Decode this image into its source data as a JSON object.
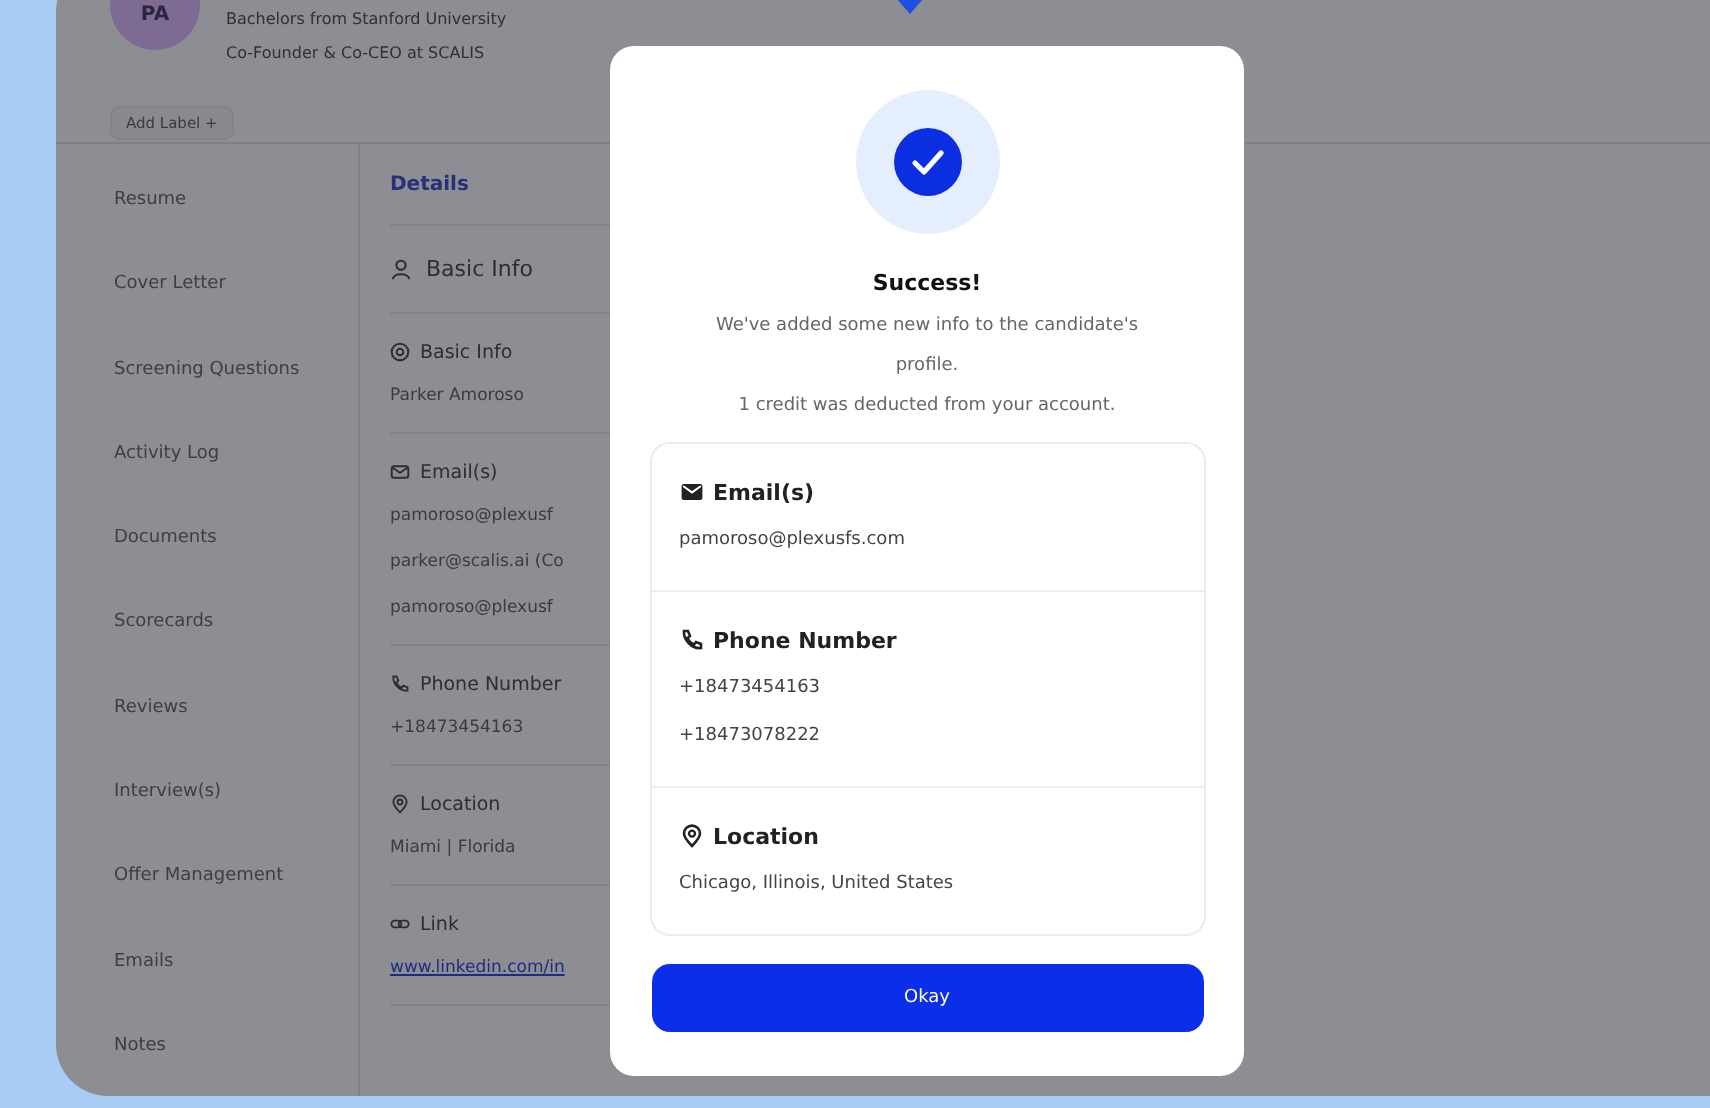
{
  "profile": {
    "avatar_initials": "PA",
    "education": "Bachelors from Stanford University",
    "position": "Co-Founder & Co-CEO at SCALIS",
    "add_label_button": "Add Label +"
  },
  "sidebar": {
    "items": [
      "Resume",
      "Cover Letter",
      "Screening Questions",
      "Activity Log",
      "Documents",
      "Scorecards",
      "Reviews",
      "Interview(s)",
      "Offer Management",
      "Emails",
      "Notes"
    ]
  },
  "details": {
    "heading": "Details",
    "section_header": "Basic Info",
    "sections": [
      {
        "kind": "name",
        "title": "Basic Info",
        "values": [
          "Parker Amoroso"
        ]
      },
      {
        "kind": "email",
        "title": "Email(s)",
        "values": [
          "pamoroso@plexusf",
          "parker@scalis.ai (Co",
          "pamoroso@plexusf"
        ]
      },
      {
        "kind": "phone",
        "title": "Phone Number",
        "values": [
          "+18473454163"
        ]
      },
      {
        "kind": "location",
        "title": "Location",
        "values": [
          "Miami | Florida"
        ]
      },
      {
        "kind": "link",
        "title": "Link",
        "values": [
          "www.linkedin.com/in"
        ]
      }
    ]
  },
  "modal": {
    "title": "Success!",
    "message_lines": [
      "We've added some new info to the candidate's profile.",
      "1 credit was deducted from your account."
    ],
    "sections": [
      {
        "kind": "email",
        "title": "Email(s)",
        "values": [
          "pamoroso@plexusfs.com"
        ]
      },
      {
        "kind": "phone",
        "title": "Phone Number",
        "values": [
          "+18473454163",
          "+18473078222"
        ]
      },
      {
        "kind": "location",
        "title": "Location",
        "values": [
          "Chicago, Illinois, United States"
        ]
      }
    ],
    "button": "Okay"
  }
}
